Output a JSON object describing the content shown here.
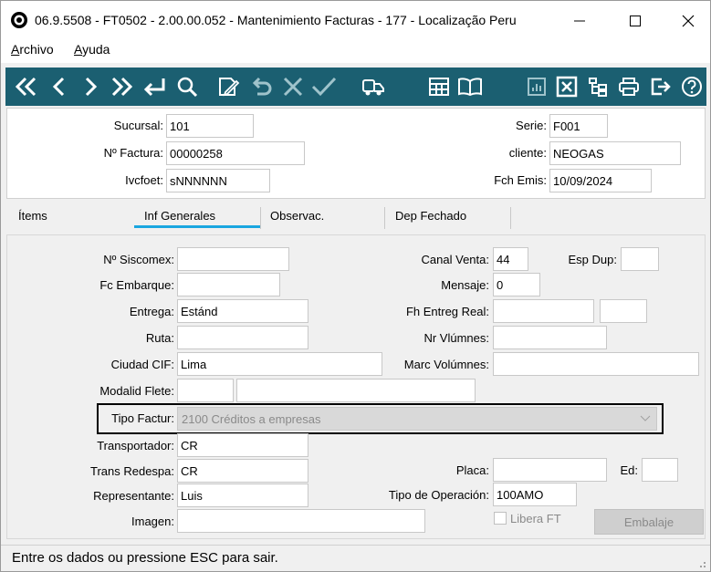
{
  "window": {
    "title": "06.9.5508 - FT0502 - 2.00.00.052 - Mantenimiento Facturas - 177 - Localização Peru"
  },
  "menu": {
    "archivo_key": "A",
    "archivo_rest": "rchivo",
    "ayuda_key": "A",
    "ayuda_rest": "yuda"
  },
  "toolbar_icons": [
    "first-icon",
    "prev-icon",
    "next-icon",
    "last-icon",
    "enter-icon",
    "search-icon",
    "edit-icon",
    "undo-icon",
    "delete-icon",
    "confirm-icon",
    "truck-icon",
    "calculator-icon",
    "book-icon",
    "report-icon",
    "cancel-icon",
    "tree-icon",
    "print-icon",
    "exit-icon",
    "help-icon"
  ],
  "header": {
    "sucursal_label": "Sucursal:",
    "sucursal_value": "101",
    "factura_label": "Nº Factura:",
    "factura_value": "00000258",
    "ivcfoet_label": "Ivcfoet:",
    "ivcfoet_value": "sNNNNNN",
    "serie_label": "Serie:",
    "serie_value": "F001",
    "cliente_label": "cliente:",
    "cliente_value": "NEOGAS",
    "fch_emis_label": "Fch Emis:",
    "fch_emis_value": "10/09/2024"
  },
  "tabs": [
    "Ítems",
    "Inf Generales",
    "Observac.",
    "Dep Fechado"
  ],
  "form": {
    "siscomex_label": "Nº Siscomex:",
    "siscomex_value": "",
    "fc_embarque_label": "Fc Embarque:",
    "fc_embarque_value": "",
    "entrega_label": "Entrega:",
    "entrega_value": "Estánd",
    "ruta_label": "Ruta:",
    "ruta_value": "",
    "ciudad_cif_label": "Ciudad CIF:",
    "ciudad_cif_value": "Lima",
    "modalid_flete_label": "Modalid Flete:",
    "modalid_flete_value": "",
    "modalid_flete_desc": "",
    "tipo_factur_label": "Tipo Factur:",
    "tipo_factur_value": "2100 Créditos a empresas",
    "transportador_label": "Transportador:",
    "transportador_value": "CR",
    "trans_redespa_label": "Trans Redespa:",
    "trans_redespa_value": "CR",
    "representante_label": "Representante:",
    "representante_value": "Luis",
    "imagen_label": "Imagen:",
    "imagen_value": "",
    "canal_venta_label": "Canal Venta:",
    "canal_venta_value": "44",
    "esp_dup_label": "Esp Dup:",
    "esp_dup_value": "",
    "mensaje_label": "Mensaje:",
    "mensaje_value": "0",
    "fh_entreg_real_label": "Fh Entreg Real:",
    "fh_entreg_real_value": "",
    "fh_entreg_real_time": "",
    "nr_volumnes_label": "Nr Vlúmnes:",
    "nr_volumnes_value": "",
    "marc_volumnes_label": "Marc Volúmnes:",
    "marc_volumnes_value": "",
    "placa_label": "Placa:",
    "placa_value": "",
    "ed_label": "Ed:",
    "ed_value": "",
    "tipo_operacion_label": "Tipo de Operación:",
    "tipo_operacion_value": "100AMO",
    "libera_ft_label": "Libera FT",
    "embalaje_label": "Embalaje"
  },
  "status": {
    "message": "Entre os dados ou pressione ESC para sair."
  }
}
